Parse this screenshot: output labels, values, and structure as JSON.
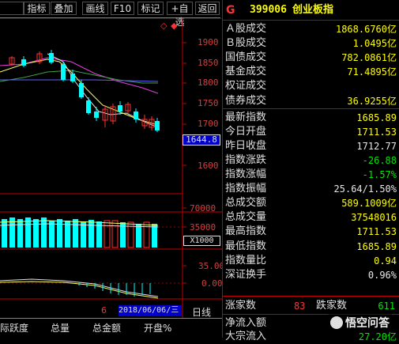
{
  "toolbar": {
    "items": [
      "指标",
      "叠加",
      "画线",
      "F10",
      "标记",
      "+自选",
      "返回"
    ]
  },
  "chart_controls": {
    "diamond1": "◇",
    "diamond2": "◆"
  },
  "price_axis": [
    "1900",
    "1850",
    "1800",
    "1750",
    "1700",
    "1600"
  ],
  "current_price_tag": "1644.8",
  "volume_axis": [
    "70000",
    "35000"
  ],
  "volume_unit": "X1000",
  "indicator_axis": [
    "35.00",
    "0.00"
  ],
  "date_bar": {
    "left": "6",
    "date": "2018/06/06/三",
    "period": "日线"
  },
  "bottom_tabs": [
    "际跃度",
    "总量",
    "总金额",
    "开盘%"
  ],
  "header": {
    "g": "G",
    "code": "399006",
    "name": "创业板指"
  },
  "rows": [
    {
      "label": "Ａ股成交",
      "value": "1868.6760亿"
    },
    {
      "label": "Ｂ股成交",
      "value": "1.0495亿"
    },
    {
      "label": "国债成交",
      "value": "782.0861亿"
    },
    {
      "label": "基金成交",
      "value": "71.4895亿"
    },
    {
      "label": "权证成交",
      "value": ""
    },
    {
      "label": "债券成交",
      "value": "36.9255亿"
    },
    {
      "label": "最新指数",
      "value": "1685.89"
    },
    {
      "label": "今日开盘",
      "value": "1711.53"
    },
    {
      "label": "昨日收盘",
      "value": "1712.77"
    },
    {
      "label": "指数涨跌",
      "value": "-26.88"
    },
    {
      "label": "指数涨幅",
      "value": "-1.57%"
    },
    {
      "label": "指数振幅",
      "value": "25.64/1.50%"
    },
    {
      "label": "总成交额",
      "value": "589.1009亿"
    },
    {
      "label": "总成交量",
      "value": "37548016"
    },
    {
      "label": "最高指数",
      "value": "1711.53"
    },
    {
      "label": "最低指数",
      "value": "1685.89"
    },
    {
      "label": "指数量比",
      "value": "0.94"
    },
    {
      "label": "深证换手",
      "value": "0.96%"
    }
  ],
  "updown": {
    "up_label": "涨家数",
    "up_value": "83",
    "down_label": "跌家数",
    "down_value": "611"
  },
  "net_inflow": {
    "label1": "净流入额",
    "label2": "大宗流入",
    "v1": "",
    "v2": "27.20亿"
  },
  "watermark": "悟空问答",
  "colors": {
    "up": "#ff3232",
    "down": "#00ffff",
    "axis": "#c00000",
    "text": "#e0e0e0"
  }
}
